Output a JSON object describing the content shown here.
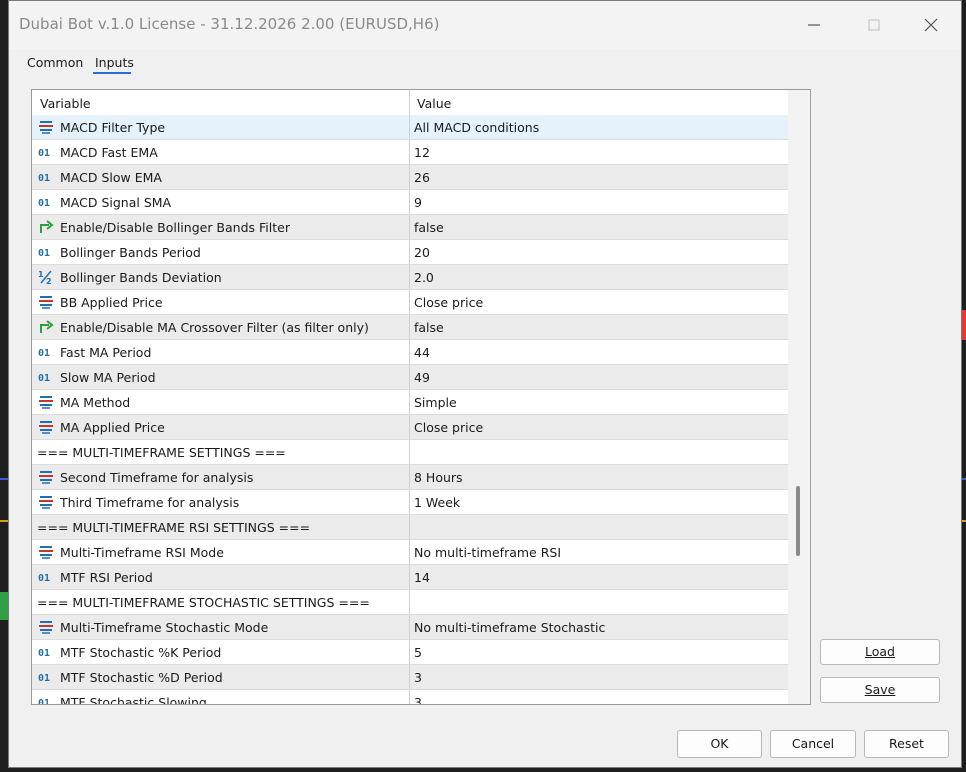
{
  "window": {
    "title": "Dubai Bot v.1.0 License - 31.12.2026 2.00 (EURUSD,H6)"
  },
  "tabs": [
    {
      "label": "Common"
    },
    {
      "label": "Inputs"
    }
  ],
  "grid": {
    "headers": {
      "variable": "Variable",
      "value": "Value"
    },
    "rows": [
      {
        "icon": "enum-icon",
        "variable": "MACD Filter Type",
        "value": "All MACD conditions"
      },
      {
        "icon": "integer-icon",
        "variable": "MACD Fast EMA",
        "value": "12"
      },
      {
        "icon": "integer-icon",
        "variable": "MACD Slow EMA",
        "value": "26"
      },
      {
        "icon": "integer-icon",
        "variable": "MACD Signal SMA",
        "value": "9"
      },
      {
        "icon": "boolean-icon",
        "variable": "Enable/Disable Bollinger Bands Filter",
        "value": "false"
      },
      {
        "icon": "integer-icon",
        "variable": "Bollinger Bands Period",
        "value": "20"
      },
      {
        "icon": "double-icon",
        "variable": "Bollinger Bands Deviation",
        "value": "2.0"
      },
      {
        "icon": "enum-icon",
        "variable": "BB Applied Price",
        "value": "Close price"
      },
      {
        "icon": "boolean-icon",
        "variable": "Enable/Disable MA Crossover Filter (as filter only)",
        "value": "false"
      },
      {
        "icon": "integer-icon",
        "variable": "Fast MA Period",
        "value": "44"
      },
      {
        "icon": "integer-icon",
        "variable": "Slow MA Period",
        "value": "49"
      },
      {
        "icon": "enum-icon",
        "variable": "MA Method",
        "value": "Simple"
      },
      {
        "icon": "enum-icon",
        "variable": "MA Applied Price",
        "value": "Close price"
      },
      {
        "icon": "",
        "variable": "=== MULTI-TIMEFRAME SETTINGS ===",
        "value": ""
      },
      {
        "icon": "enum-icon",
        "variable": "Second Timeframe for analysis",
        "value": "8 Hours"
      },
      {
        "icon": "enum-icon",
        "variable": "Third Timeframe for analysis",
        "value": "1 Week"
      },
      {
        "icon": "",
        "variable": "=== MULTI-TIMEFRAME RSI SETTINGS ===",
        "value": ""
      },
      {
        "icon": "enum-icon",
        "variable": "Multi-Timeframe RSI Mode",
        "value": "No multi-timeframe RSI"
      },
      {
        "icon": "integer-icon",
        "variable": "MTF RSI Period",
        "value": "14"
      },
      {
        "icon": "",
        "variable": "=== MULTI-TIMEFRAME STOCHASTIC SETTINGS ===",
        "value": ""
      },
      {
        "icon": "enum-icon",
        "variable": "Multi-Timeframe Stochastic Mode",
        "value": "No multi-timeframe Stochastic"
      },
      {
        "icon": "integer-icon",
        "variable": "MTF Stochastic %K Period",
        "value": "5"
      },
      {
        "icon": "integer-icon",
        "variable": "MTF Stochastic %D Period",
        "value": "3"
      },
      {
        "icon": "integer-icon",
        "variable": "MTF Stochastic Slowing",
        "value": "3"
      }
    ]
  },
  "side_buttons": {
    "load": "Load",
    "save": "Save"
  },
  "footer_buttons": {
    "ok": "OK",
    "cancel": "Cancel",
    "reset": "Reset"
  },
  "colors": {
    "accent": "#2a6edb",
    "selected_row": "#e5f1fb",
    "enum_icon": "#c0392b",
    "integer_icon": "#1f6fb2",
    "boolean_icon": "#2e9e3e"
  }
}
